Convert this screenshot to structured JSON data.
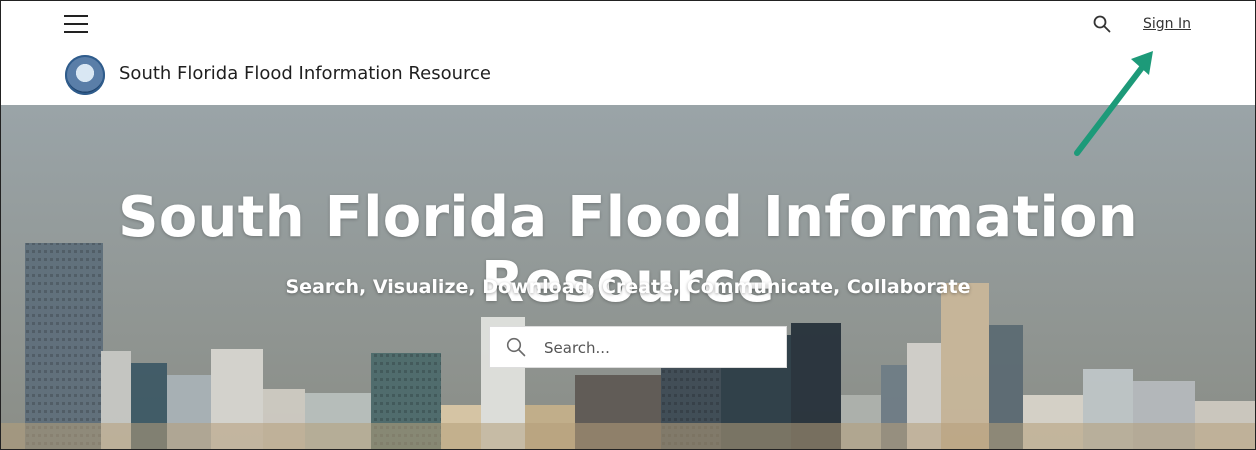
{
  "header": {
    "site_title": "South Florida Flood Information Resource",
    "signin_label": "Sign In"
  },
  "hero": {
    "title": "South Florida Flood Information Resource",
    "subtitle": "Search, Visualize, Download, Create, Communicate, Collaborate",
    "search_placeholder": "Search..."
  },
  "colors": {
    "annotation_arrow": "#1d9a79",
    "hero_text": "#ffffff"
  }
}
